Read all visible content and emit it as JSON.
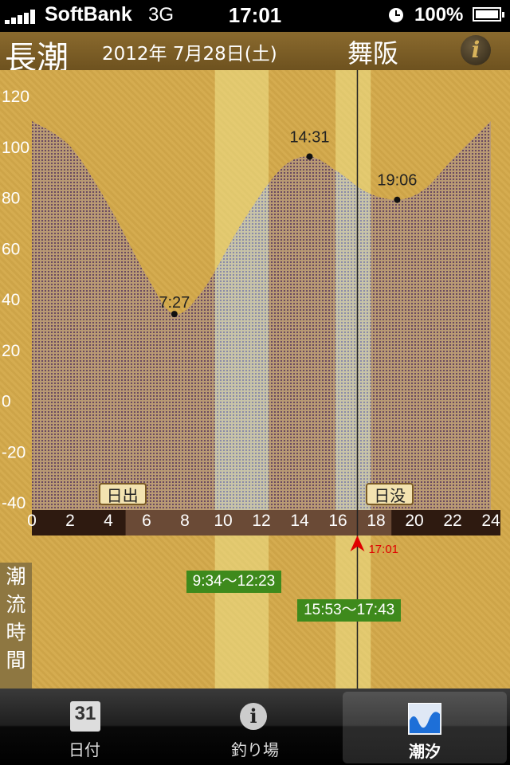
{
  "status_bar": {
    "carrier": "SoftBank",
    "network": "3G",
    "time": "17:01",
    "battery": "100%"
  },
  "header": {
    "tide_type": "長潮",
    "date": "2012年 7月28日(土)",
    "location": "舞阪",
    "info_icon": "info-icon"
  },
  "chart_data": {
    "type": "area",
    "y_ticks": [
      "120",
      "100",
      "80",
      "60",
      "40",
      "20",
      "0",
      "-20",
      "-40"
    ],
    "ylim": [
      -40,
      120
    ],
    "x_ticks": [
      "0",
      "2",
      "4",
      "6",
      "8",
      "10",
      "12",
      "14",
      "16",
      "18",
      "20",
      "22",
      "24"
    ],
    "xlim": [
      0,
      24
    ],
    "curve": [
      [
        0,
        110
      ],
      [
        2,
        100
      ],
      [
        4,
        77
      ],
      [
        6,
        49
      ],
      [
        7.45,
        34
      ],
      [
        9,
        44
      ],
      [
        11,
        70
      ],
      [
        13,
        91
      ],
      [
        14.52,
        96
      ],
      [
        16,
        90
      ],
      [
        17.5,
        82
      ],
      [
        19.1,
        79
      ],
      [
        20.5,
        83
      ],
      [
        22,
        95
      ],
      [
        24,
        110
      ]
    ],
    "extrema": [
      {
        "label": "7:27",
        "x": 7.45,
        "y": 34
      },
      {
        "label": "14:31",
        "x": 14.52,
        "y": 96
      },
      {
        "label": "19:06",
        "x": 19.1,
        "y": 79
      }
    ],
    "sunrise": {
      "label": "日出",
      "x": 4.9
    },
    "sunset": {
      "label": "日没",
      "x": 18.8
    },
    "current_time": {
      "label": "17:01",
      "x": 17.02
    },
    "fishing_windows": [
      {
        "label": "9:34〜12:23",
        "start": 9.57,
        "end": 12.38
      },
      {
        "label": "15:53〜17:43",
        "start": 15.88,
        "end": 17.72
      }
    ]
  },
  "tide_flow_label": [
    "潮",
    "流",
    "時",
    "間"
  ],
  "tabbar": {
    "tabs": [
      {
        "label": "日付",
        "icon": "calendar-icon",
        "icon_text": "31"
      },
      {
        "label": "釣り場",
        "icon": "info-icon",
        "icon_text": "i"
      },
      {
        "label": "潮汐",
        "icon": "tide-graph-icon",
        "selected": true
      }
    ]
  }
}
